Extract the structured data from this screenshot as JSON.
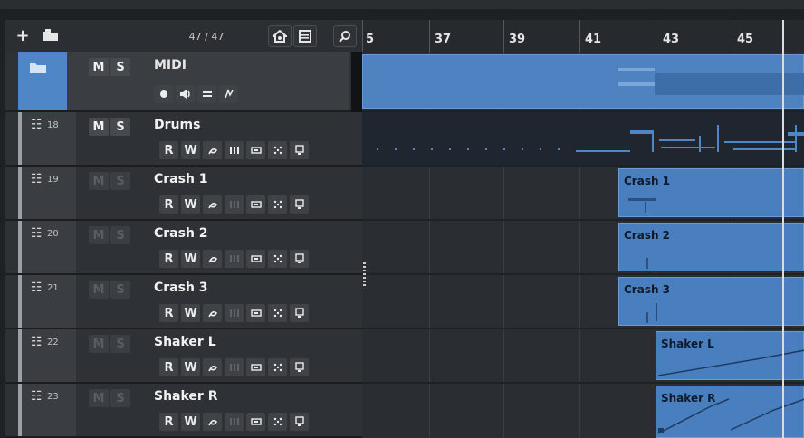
{
  "toolbar": {
    "add_track_label": "+",
    "track_count": "47 / 47"
  },
  "folder_track": {
    "name": "MIDI",
    "mute_label": "M",
    "solo_label": "S",
    "color": "#4f86c6"
  },
  "tracks": [
    {
      "number": "18",
      "name": "Drums",
      "mute_label": "M",
      "solo_label": "S",
      "read_label": "R",
      "write_label": "W",
      "ms_active": true
    },
    {
      "number": "19",
      "name": "Crash 1",
      "mute_label": "M",
      "solo_label": "S",
      "read_label": "R",
      "write_label": "W",
      "ms_active": false
    },
    {
      "number": "20",
      "name": "Crash 2",
      "mute_label": "M",
      "solo_label": "S",
      "read_label": "R",
      "write_label": "W",
      "ms_active": false
    },
    {
      "number": "21",
      "name": "Crash 3",
      "mute_label": "M",
      "solo_label": "S",
      "read_label": "R",
      "write_label": "W",
      "ms_active": false
    },
    {
      "number": "22",
      "name": "Shaker L",
      "mute_label": "M",
      "solo_label": "S",
      "read_label": "R",
      "write_label": "W",
      "ms_active": false
    },
    {
      "number": "23",
      "name": "Shaker R",
      "mute_label": "M",
      "solo_label": "S",
      "read_label": "R",
      "write_label": "W",
      "ms_active": false
    }
  ],
  "ruler": {
    "bars": [
      "5",
      "37",
      "39",
      "41",
      "43",
      "45"
    ]
  },
  "parts": [
    {
      "title": "Crash 1"
    },
    {
      "title": "Crash 2"
    },
    {
      "title": "Crash 3"
    },
    {
      "title": "Shaker L"
    },
    {
      "title": "Shaker R"
    }
  ],
  "colors": {
    "part_blue": "#4a7fbf",
    "background": "#1e2124"
  }
}
